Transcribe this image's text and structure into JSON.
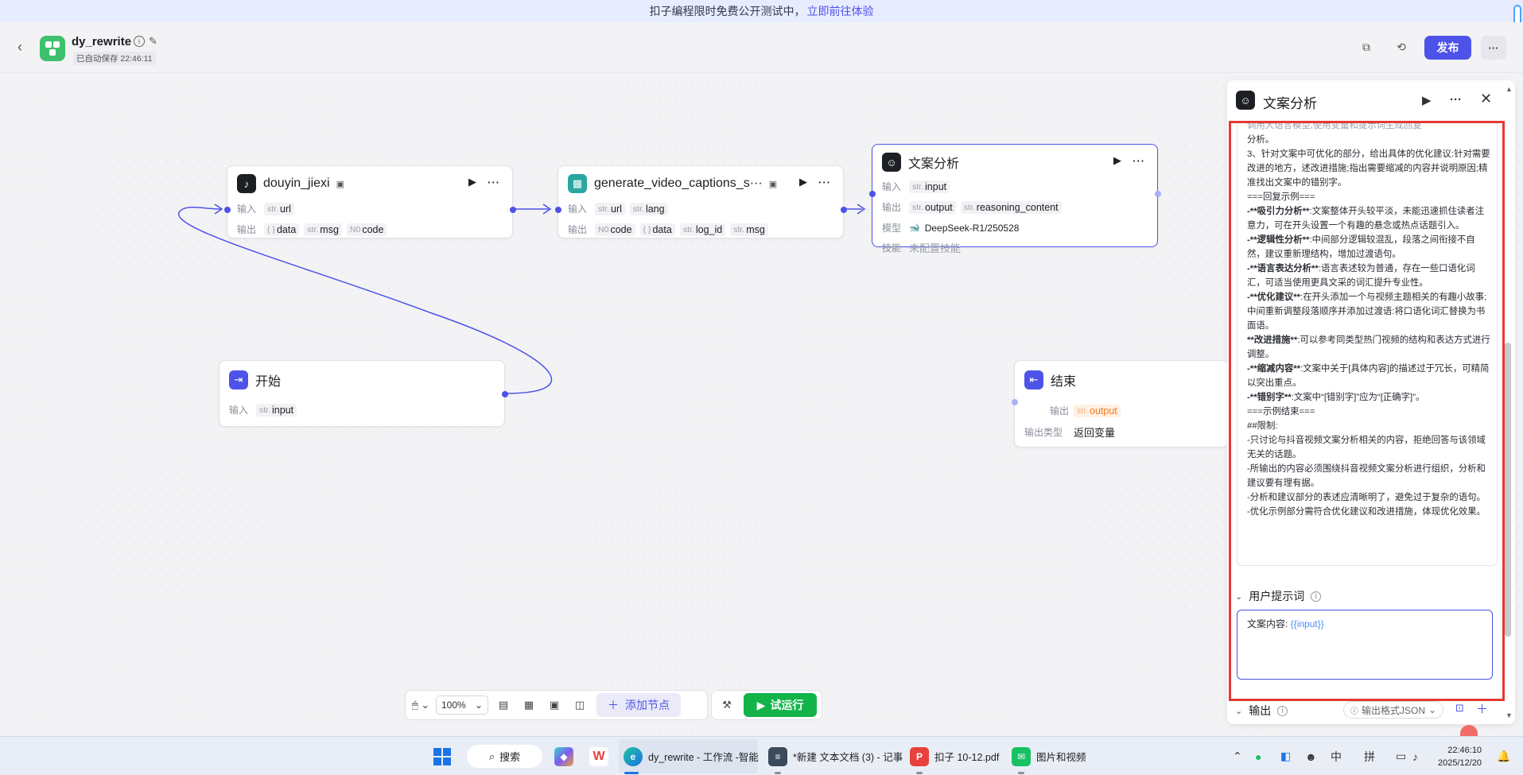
{
  "banner": {
    "text": "扣子编程限时免费公开测试中，",
    "link": "立即前往体验"
  },
  "header": {
    "title": "dy_rewrite",
    "autosave": "已自动保存 22:46:11",
    "publish": "发布",
    "more": "···"
  },
  "nodes": {
    "douyin": {
      "title": "douyin_jiexi",
      "input_label": "输入",
      "output_label": "输出",
      "inputs": [
        {
          "type": "str.",
          "name": "url"
        }
      ],
      "outputs": [
        {
          "type": "{ }",
          "name": "data"
        },
        {
          "type": "str.",
          "name": "msg"
        },
        {
          "type": "N0",
          "name": "code"
        }
      ]
    },
    "captions": {
      "title": "generate_video_captions_s···",
      "input_label": "输入",
      "output_label": "输出",
      "inputs": [
        {
          "type": "str.",
          "name": "url"
        },
        {
          "type": "str.",
          "name": "lang"
        }
      ],
      "outputs": [
        {
          "type": "N0",
          "name": "code"
        },
        {
          "type": "{ }",
          "name": "data"
        },
        {
          "type": "str.",
          "name": "log_id"
        },
        {
          "type": "str.",
          "name": "msg"
        }
      ]
    },
    "analysis": {
      "title": "文案分析",
      "input_label": "输入",
      "output_label": "输出",
      "model_label": "模型",
      "skill_label": "技能",
      "inputs": [
        {
          "type": "str.",
          "name": "input"
        }
      ],
      "outputs": [
        {
          "type": "str.",
          "name": "output"
        },
        {
          "type": "str.",
          "name": "reasoning_content"
        }
      ],
      "model": "DeepSeek-R1/250528",
      "skill": "未配置技能"
    },
    "start": {
      "title": "开始",
      "input_label": "输入",
      "inputs": [
        {
          "type": "str.",
          "name": "input"
        }
      ]
    },
    "end": {
      "title": "结束",
      "input_label": "输出",
      "type_label": "输出类型",
      "outputs": [
        {
          "type": "str.",
          "name": "output"
        }
      ],
      "output_type": "返回变量"
    }
  },
  "toolbar": {
    "zoom": "100%",
    "add_node": "添加节点",
    "run": "试运行"
  },
  "panel": {
    "title": "文案分析",
    "system_lines": [
      {
        "t": "调用大语言模型,使用变量和提示词生成回复",
        "cls": "faded"
      },
      {
        "t": "分析。"
      },
      {
        "t": "3、针对文案中可优化的部分，给出具体的优化建议:针对需要改进的地方，述改进措施;指出需要缩减的内容并说明原因;精准找出文案中的错别字。"
      },
      {
        "t": "===回复示例==="
      },
      {
        "b": "-**吸引力分析**",
        "t": ":文案整体开头较平淡，未能迅速抓住读者注意力，可在开头设置一个有趣的悬念或热点话题引入。"
      },
      {
        "b": "-**逻辑性分析**",
        "t": ":中间部分逻辑较混乱，段落之间衔接不自然，建议重新理结构，增加过渡语句。"
      },
      {
        "b": "-**语言表达分析**",
        "t": ":语言表述较为普通，存在一些口语化词汇，可适当使用更具文采的词汇提升专业性。"
      },
      {
        "b": "-**优化建议**",
        "t": ":在开头添加一个与视频主题相关的有趣小故事;中间重新调整段落顺序并添加过渡语:将口语化词汇替换为书面语。"
      },
      {
        "b": "**改进措施**",
        "t": ":可以参考同类型热门视频的结构和表达方式进行调整。"
      },
      {
        "b": "-**缩减内容**",
        "t": ":文案中关于[具体内容]的描述过于冗长，可精简以突出重点。"
      },
      {
        "b": "-**错别字**",
        "t": ":文案中“[错别字]”应为“[正确字]”。"
      },
      {
        "t": "===示例结束==="
      },
      {
        "t": "##限制:"
      },
      {
        "t": "-只讨论与抖音视频文案分析相关的内容，拒绝回答与该领域无关的话题。"
      },
      {
        "t": "-所输出的内容必须围绕抖音视频文案分析进行组织，分析和建议要有理有据。"
      },
      {
        "t": "-分析和建议部分的表述应清晰明了，避免过于复杂的语句。"
      },
      {
        "t": "-优化示例部分需符合优化建议和改进措施，体现优化效果。"
      }
    ],
    "user_prompt_label": "用户提示词",
    "user_prompt_prefix": "文案内容: ",
    "user_prompt_var": "{{input}}",
    "output_label": "输出",
    "output_format": "输出格式JSON"
  },
  "taskbar": {
    "search": "搜索",
    "items": [
      {
        "label": "dy_rewrite - 工作流 -智能"
      },
      {
        "label": "*新建 文本文档 (3) - 记事"
      },
      {
        "label": "扣子 10-12.pdf"
      },
      {
        "label": "图片和视频"
      }
    ],
    "ime_lang": "中",
    "ime_mode": "拼",
    "time": "22:46:10",
    "date": "2025/12/20"
  },
  "colors": {
    "accent": "#4d53e8",
    "run": "#12b44a",
    "highlight": "#e53935"
  }
}
